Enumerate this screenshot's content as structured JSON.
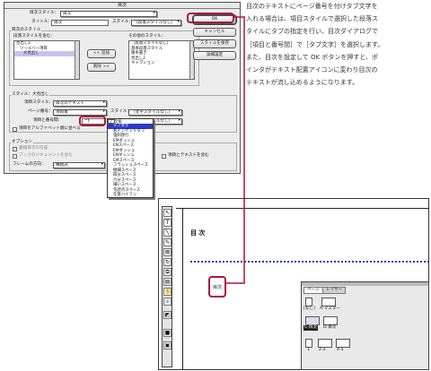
{
  "dialog": {
    "title": "目次",
    "title_style_label": "目次スタイル：",
    "title_style_value": "目次",
    "title_label": "タイトル：",
    "title_value": "目次",
    "title_para_style_label": "スタイル：",
    "title_para_style_value": "［段落スタイルなし］",
    "toc_style_group": "目次のスタイル",
    "include_label": "段落スタイルを含む：",
    "include_items": [
      "見出し1",
      "ツールバー項目",
      "大見出し"
    ],
    "other_label": "その他のスタイル：",
    "other_items": [
      "［段落スタイルなし］",
      "基本段落スタイル",
      "箇条書き",
      "見出し2",
      "キャプション"
    ],
    "add_button": "<< 追加",
    "remove_button": "削除 >>",
    "style_section_label": "スタイル：大見出し",
    "entry_style_label": "項目スタイル：",
    "entry_style_value": "目次のテキスト",
    "page_number_label": "ページ番号：",
    "page_number_value": "項目後",
    "char_style_label": "スタイル：",
    "char_style_value": "［文字スタイルなし］",
    "between_label": "項目と番号間：",
    "between_value": "^t",
    "between_style_value": "［文字スタイルなし］",
    "sort_label": "項目をアルファベット順に並べる",
    "options_group": "オプション",
    "option1": "書籍目次の作成",
    "option2": "ブックのドキュメントを含む",
    "frame_label": "フレームの方向：",
    "frame_value": "横組み",
    "run_in_label": "項目とテキストを含む",
    "buttons": [
      "OK",
      "キャンセル",
      "スタイルを保存",
      "詳細設定"
    ]
  },
  "menu": {
    "items": [
      "全角",
      "タブ文字",
      "右インデントタブ",
      "強制改行",
      "EMダッシュ",
      "ENスペース",
      "EMダッシュ",
      "ENダッシュ",
      "EMスペース",
      "フラッシュスペース",
      "極細スペース",
      "四分スペース",
      "六分スペース",
      "細いスペース",
      "句読点スペース",
      "任意ハイフン"
    ],
    "highlighted_index": 1,
    "checked_index": 0
  },
  "paragraph_lines": [
    "目次のテキストにページ番号を付けタブ文字を",
    "入れる場合は、項目スタイルで選択した段落ス",
    "タイルにタブの指定を行い、目次ダイアログで",
    "［項目と番号間］で［タブ文字］を選択します。",
    "また、目次を設定して OK ボタンを押すと、ポ",
    "インタがテキスト配置アイコンに変わり目次の",
    "テキストが流し込めるようになります。"
  ],
  "document": {
    "heading": "目 次",
    "cursor_label": "目次"
  },
  "pages_panel": {
    "tabs": [
      "ページ",
      "レイヤー"
    ],
    "masters": [
      "[なし]",
      "A-マスター"
    ],
    "spread_labels": [
      "C-目次",
      "D-目次"
    ],
    "page_numbers": [
      "1",
      "2-3",
      "4-5"
    ]
  },
  "tools": [
    "selection-tool",
    "type-tool",
    "line-tool",
    "pen-tool",
    "rectangle-frame-tool",
    "rotate-tool",
    "scale-tool",
    "gradient-tool",
    "hand-tool",
    "zoom-tool",
    "fill-stroke-swatch",
    "apply-color",
    "view-mode"
  ],
  "colors": {
    "callout_red": "#b0123b",
    "menu_highlight": "#2a3cc6",
    "list_selection": "#c9c2ee",
    "dotted_guide": "#1f3f9e"
  }
}
